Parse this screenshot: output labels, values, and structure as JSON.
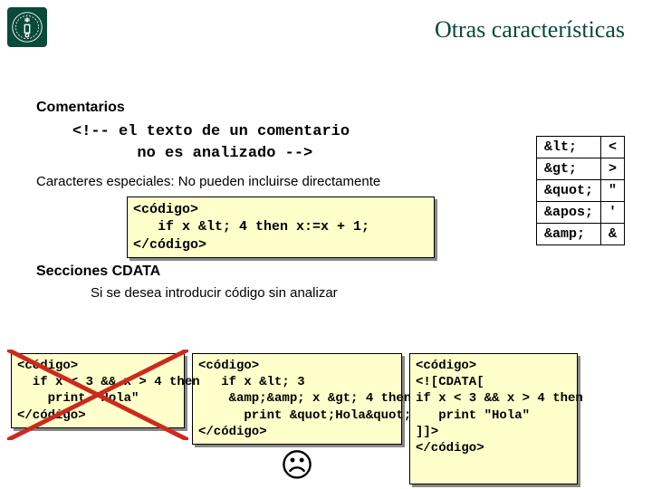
{
  "title": "Otras características",
  "headings": {
    "comments": "Comentarios",
    "specialchars": "Caracteres especiales: No pueden incluirse directamente",
    "cdata": "Secciones CDATA",
    "cdataDesc": "Si se desea introducir código sin analizar"
  },
  "code": {
    "comment": "<!-- el texto de un comentario\n       no es analizado -->",
    "escaped": "<código>\n   if x &lt; 4 then x:=x + 1;\n</código>",
    "bad1": "<código>\n  if x < 3 && x > 4 then\n    print \"Hola\"\n</código>",
    "bad2": "<código>\n   if x &lt; 3\n    &amp;&amp; x &gt; 4 then\n      print &quot;Hola&quot;\n</código>",
    "good": "<código>\n<![CDATA[\nif x < 3 && x > 4 then\n   print \"Hola\"\n]]>\n</código>"
  },
  "entities": [
    {
      "e": "&lt;",
      "c": "<"
    },
    {
      "e": "&gt;",
      "c": ">"
    },
    {
      "e": "&quot;",
      "c": "\""
    },
    {
      "e": "&apos;",
      "c": "'"
    },
    {
      "e": "&amp;",
      "c": "&"
    }
  ],
  "sadface": "☹"
}
